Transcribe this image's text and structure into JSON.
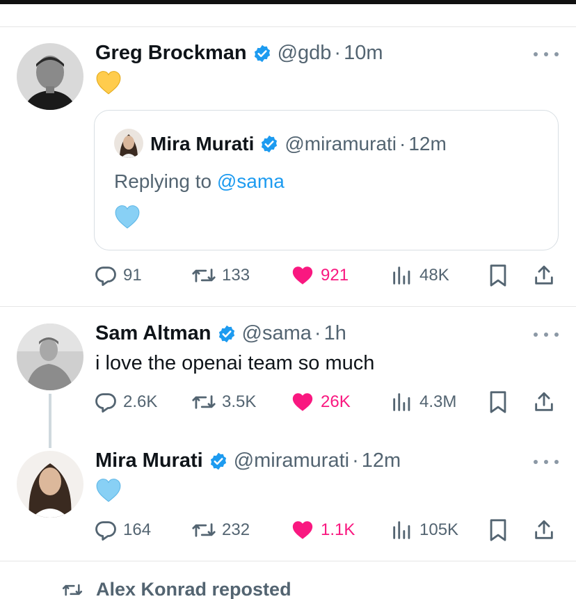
{
  "colors": {
    "accent": "#1d9bf0",
    "like": "#f91880",
    "secondary": "#536471",
    "verified": "#1d9bf0"
  },
  "tweets": [
    {
      "name": "Greg Brockman",
      "handle": "@gdb",
      "separator": "·",
      "time": "10m",
      "emoji": "yellow-heart",
      "quote": {
        "name": "Mira Murati",
        "handle": "@miramurati",
        "separator": "·",
        "time": "12m",
        "replying_prefix": "Replying to ",
        "replying_handle": "@sama",
        "emoji": "light-blue-heart"
      },
      "stats": {
        "replies": "91",
        "reposts": "133",
        "likes": "921",
        "views": "48K"
      }
    },
    {
      "name": "Sam Altman",
      "handle": "@sama",
      "separator": "·",
      "time": "1h",
      "text": "i love the openai team so much",
      "stats": {
        "replies": "2.6K",
        "reposts": "3.5K",
        "likes": "26K",
        "views": "4.3M"
      }
    },
    {
      "name": "Mira Murati",
      "handle": "@miramurati",
      "separator": "·",
      "time": "12m",
      "emoji": "light-blue-heart",
      "stats": {
        "replies": "164",
        "reposts": "232",
        "likes": "1.1K",
        "views": "105K"
      }
    }
  ],
  "repost_notice": {
    "text": "Alex Konrad reposted"
  },
  "icons": {
    "reply": "reply-icon",
    "repost": "repost-icon",
    "like": "heart-icon",
    "views": "views-icon",
    "bookmark": "bookmark-icon",
    "share": "share-icon",
    "more": "more-icon",
    "verified": "verified-badge-icon"
  }
}
